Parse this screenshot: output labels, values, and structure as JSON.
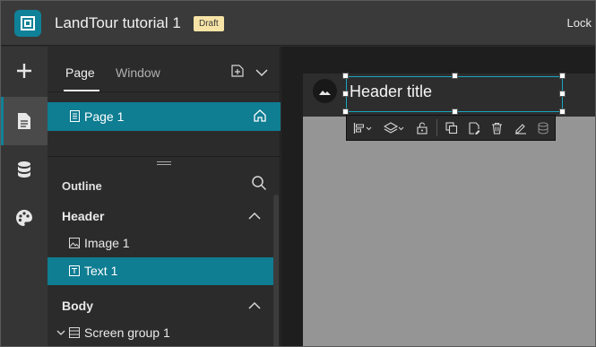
{
  "app": {
    "title": "LandTour tutorial 1",
    "status_badge": "Draft",
    "lock_label": "Lock"
  },
  "rail": {
    "items": [
      {
        "icon": "plus-icon"
      },
      {
        "icon": "page-document-icon",
        "active": true
      },
      {
        "icon": "database-icon"
      },
      {
        "icon": "palette-icon"
      }
    ]
  },
  "panel": {
    "tabs": [
      {
        "label": "Page",
        "active": true
      },
      {
        "label": "Window"
      }
    ],
    "pages": [
      {
        "label": "Page 1",
        "selected": true
      }
    ],
    "outline_title": "Outline",
    "sections": [
      {
        "title": "Header",
        "items": [
          {
            "label": "Image 1",
            "icon": "image-icon"
          },
          {
            "label": "Text 1",
            "icon": "text-icon",
            "selected": true
          }
        ]
      },
      {
        "title": "Body",
        "items": [
          {
            "label": "Screen group 1",
            "icon": "screen-group-icon"
          }
        ]
      }
    ]
  },
  "canvas": {
    "header_title": "Header title"
  }
}
